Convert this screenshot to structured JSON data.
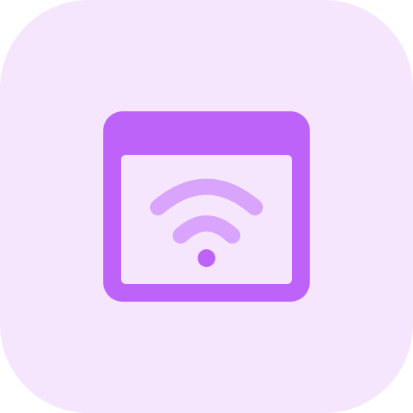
{
  "icon": {
    "name": "browser-window-wifi-icon",
    "colors": {
      "background": "#F5E6FE",
      "window": "#BE63F9",
      "wifi": "#D9A4FC",
      "content": "#F5E6FE"
    }
  }
}
